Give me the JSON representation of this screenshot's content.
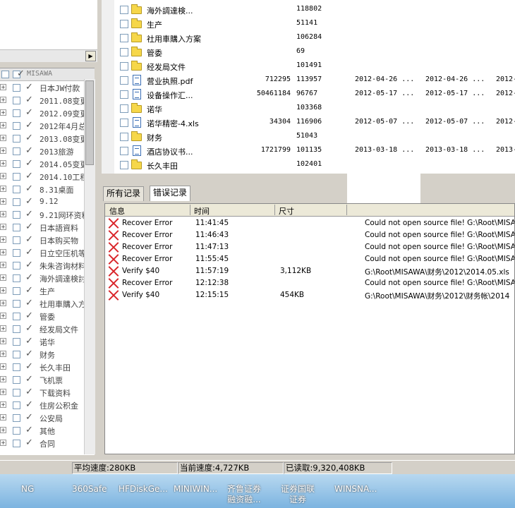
{
  "left_tree": {
    "header_label": "MISAWA",
    "items": [
      {
        "label": "日本JW付款",
        "checked": true
      },
      {
        "label": "2011.08变更",
        "checked": true
      },
      {
        "label": "2012.09变更",
        "checked": true
      },
      {
        "label": "2012年4月总",
        "checked": true
      },
      {
        "label": "2013.08变更",
        "checked": true
      },
      {
        "label": "2013旅游",
        "checked": true
      },
      {
        "label": "2014.05变更",
        "checked": true
      },
      {
        "label": "2014.10工程",
        "checked": true
      },
      {
        "label": "8.31桌面",
        "checked": true
      },
      {
        "label": "9.12",
        "checked": true
      },
      {
        "label": "9.21网环资料",
        "checked": true
      },
      {
        "label": "日本語資料",
        "checked": true
      },
      {
        "label": "日本购买物",
        "checked": true
      },
      {
        "label": "日立空压机等",
        "checked": true
      },
      {
        "label": "朱朱咨询材料",
        "checked": true
      },
      {
        "label": "海外調達検討",
        "checked": true
      },
      {
        "label": "生产",
        "checked": true
      },
      {
        "label": "社用車購入方",
        "checked": true
      },
      {
        "label": "管委",
        "checked": true
      },
      {
        "label": "经发局文件",
        "checked": true
      },
      {
        "label": "诺华",
        "checked": true
      },
      {
        "label": "财务",
        "checked": true
      },
      {
        "label": "长久丰田",
        "checked": true
      },
      {
        "label": "飞机票",
        "checked": true
      },
      {
        "label": "下载资料",
        "checked": true
      },
      {
        "label": "住房公积金",
        "checked": true
      },
      {
        "label": "公安局",
        "checked": true
      },
      {
        "label": "其他",
        "checked": true
      },
      {
        "label": "合同",
        "checked": true
      }
    ]
  },
  "file_list": {
    "rows": [
      {
        "type": "folder",
        "name": "海外調達検...",
        "size": "",
        "id": "118802",
        "d1": "",
        "d2": "",
        "d3": ""
      },
      {
        "type": "folder",
        "name": "生产",
        "size": "",
        "id": "51141",
        "d1": "",
        "d2": "",
        "d3": ""
      },
      {
        "type": "folder",
        "name": "社用車購入方案",
        "size": "",
        "id": "106284",
        "d1": "",
        "d2": "",
        "d3": ""
      },
      {
        "type": "folder",
        "name": "管委",
        "size": "",
        "id": "69",
        "d1": "",
        "d2": "",
        "d3": ""
      },
      {
        "type": "folder",
        "name": "经发局文件",
        "size": "",
        "id": "101491",
        "d1": "",
        "d2": "",
        "d3": ""
      },
      {
        "type": "file",
        "name": "营业执照.pdf",
        "size": "712295",
        "id": "113957",
        "d1": "2012-04-26  ...",
        "d2": "2012-04-26  ...",
        "d3": "2012-"
      },
      {
        "type": "file",
        "name": "设备操作汇...",
        "size": "50461184",
        "id": "96767",
        "d1": "2012-05-17  ...",
        "d2": "2012-05-17  ...",
        "d3": "2012-"
      },
      {
        "type": "folder",
        "name": "诺华",
        "size": "",
        "id": "103368",
        "d1": "",
        "d2": "",
        "d3": ""
      },
      {
        "type": "file",
        "name": "诺华精密-4.xls",
        "size": "34304",
        "id": "116906",
        "d1": "2012-05-07  ...",
        "d2": "2012-05-07  ...",
        "d3": "2012-"
      },
      {
        "type": "folder",
        "name": "财务",
        "size": "",
        "id": "51043",
        "d1": "",
        "d2": "",
        "d3": ""
      },
      {
        "type": "file",
        "name": "酒店协议书...",
        "size": "1721799",
        "id": "101135",
        "d1": "2013-03-18  ...",
        "d2": "2013-03-18  ...",
        "d3": "2013-"
      },
      {
        "type": "folder",
        "name": "长久丰田",
        "size": "",
        "id": "102401",
        "d1": "",
        "d2": "",
        "d3": ""
      }
    ]
  },
  "tabs": {
    "all_records": "所有记录",
    "error_records": "错误记录"
  },
  "log": {
    "headers": {
      "info": "信息",
      "time": "时间",
      "size": "尺寸"
    },
    "rows": [
      {
        "msg": "Recover Error",
        "time": "11:41:45",
        "size": "",
        "detail": "Could not open source file! G:\\Root\\MISAWA"
      },
      {
        "msg": "Recover Error",
        "time": "11:46:43",
        "size": "",
        "detail": "Could not open source file! G:\\Root\\MISAWA"
      },
      {
        "msg": "Recover Error",
        "time": "11:47:13",
        "size": "",
        "detail": "Could not open source file! G:\\Root\\MISAWA"
      },
      {
        "msg": "Recover Error",
        "time": "11:55:45",
        "size": "",
        "detail": "Could not open source file! G:\\Root\\MISAWA"
      },
      {
        "msg": "Verify $40",
        "time": "11:57:19",
        "size": "3,112KB",
        "detail": "G:\\Root\\MISAWA\\财务\\2012\\2014.05.xls"
      },
      {
        "msg": "Recover Error",
        "time": "12:12:38",
        "size": "",
        "detail": "Could not open source file! G:\\Root\\MISAWA"
      },
      {
        "msg": "Verify $40",
        "time": "12:15:15",
        "size": "454KB",
        "detail": "G:\\Root\\MISAWA\\财务\\2012\\财务帐\\2014"
      }
    ]
  },
  "status": {
    "avg_speed": "平均速度:280KB",
    "cur_speed": "当前速度:4,727KB",
    "read": "已读取:9,320,408KB"
  },
  "taskbar": {
    "items": [
      {
        "label": "NG"
      },
      {
        "label": "360Safe"
      },
      {
        "label": "HFDiskGe..."
      },
      {
        "label": "MINIWIN..."
      },
      {
        "label": "齐鲁证券\n融资融..."
      },
      {
        "label": "证券国联\n证券"
      },
      {
        "label": "WINSNA..."
      }
    ]
  },
  "colors": {
    "error_icon": "#d9262b",
    "folder": "#f6d74a",
    "taskbar": "#7cb4e0"
  }
}
